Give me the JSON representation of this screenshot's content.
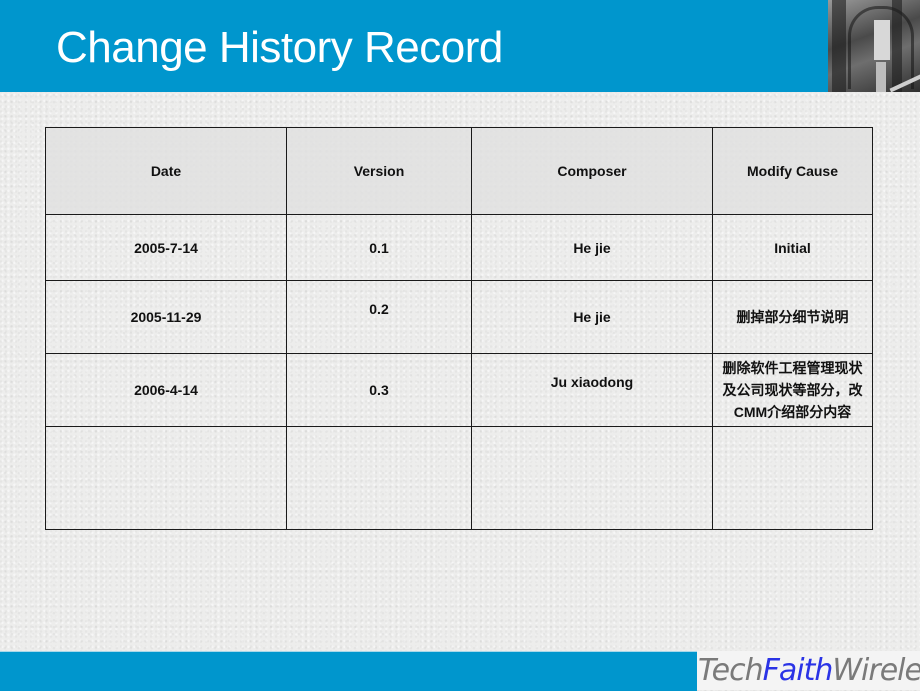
{
  "header": {
    "title": "Change History Record",
    "accent_color": "#0096cd"
  },
  "table": {
    "columns": [
      "Date",
      "Version",
      "Composer",
      "Modify Cause"
    ],
    "rows": [
      {
        "date": "2005-7-14",
        "version": "0.1",
        "composer": "He jie",
        "cause": "Initial"
      },
      {
        "date": "2005-11-29",
        "version": "0.2",
        "composer": "He jie",
        "cause": "删掉部分细节说明"
      },
      {
        "date": "2006-4-14",
        "version": "0.3",
        "composer": "Ju xiaodong",
        "cause": "删除软件工程管理现状及公司现状等部分，改CMM介绍部分内容"
      },
      {
        "date": "",
        "version": "",
        "composer": "",
        "cause": ""
      }
    ]
  },
  "footer": {
    "logo": {
      "part1": "Tech",
      "part2": "Faith",
      "part3": "Wireless"
    }
  }
}
